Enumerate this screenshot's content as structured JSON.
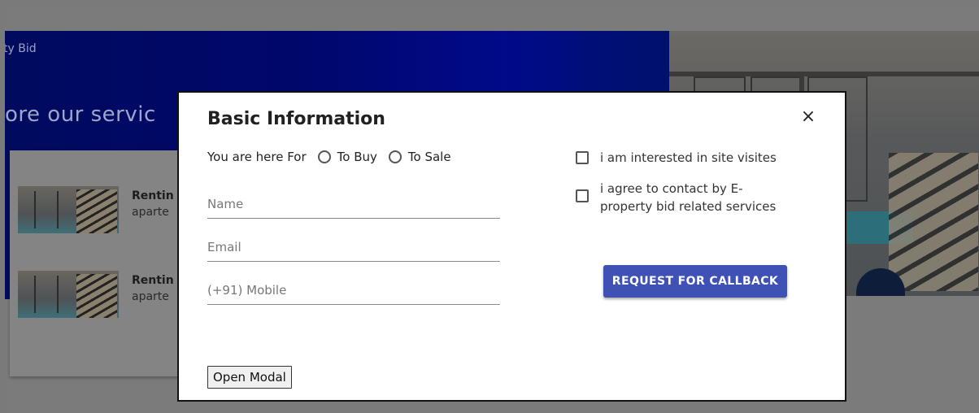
{
  "background": {
    "brand_text": "ty Bid",
    "hero_title": "ore our servic",
    "services": [
      {
        "title": "Rentin",
        "subtitle": "aparte"
      },
      {
        "title": "Rentin",
        "subtitle": "aparte"
      }
    ]
  },
  "modal": {
    "title": "Basic Information",
    "close_label": "×",
    "purpose": {
      "label": "You are here For",
      "options": [
        "To Buy",
        "To Sale"
      ]
    },
    "fields": {
      "name_placeholder": "Name",
      "email_placeholder": "Email",
      "mobile_placeholder": "(+91) Mobile"
    },
    "checkboxes": [
      {
        "label": "i am interested in site visites"
      },
      {
        "label_line1": "i agree to contact by E-",
        "label_line2": "property bid related services"
      }
    ],
    "callback_button": "REQUEST FOR CALLBACK",
    "open_modal_button": "Open Modal"
  },
  "colors": {
    "primary_button": "#3f51b5",
    "hero_blue": "#00076b",
    "overlay": "#7a7a7a"
  }
}
